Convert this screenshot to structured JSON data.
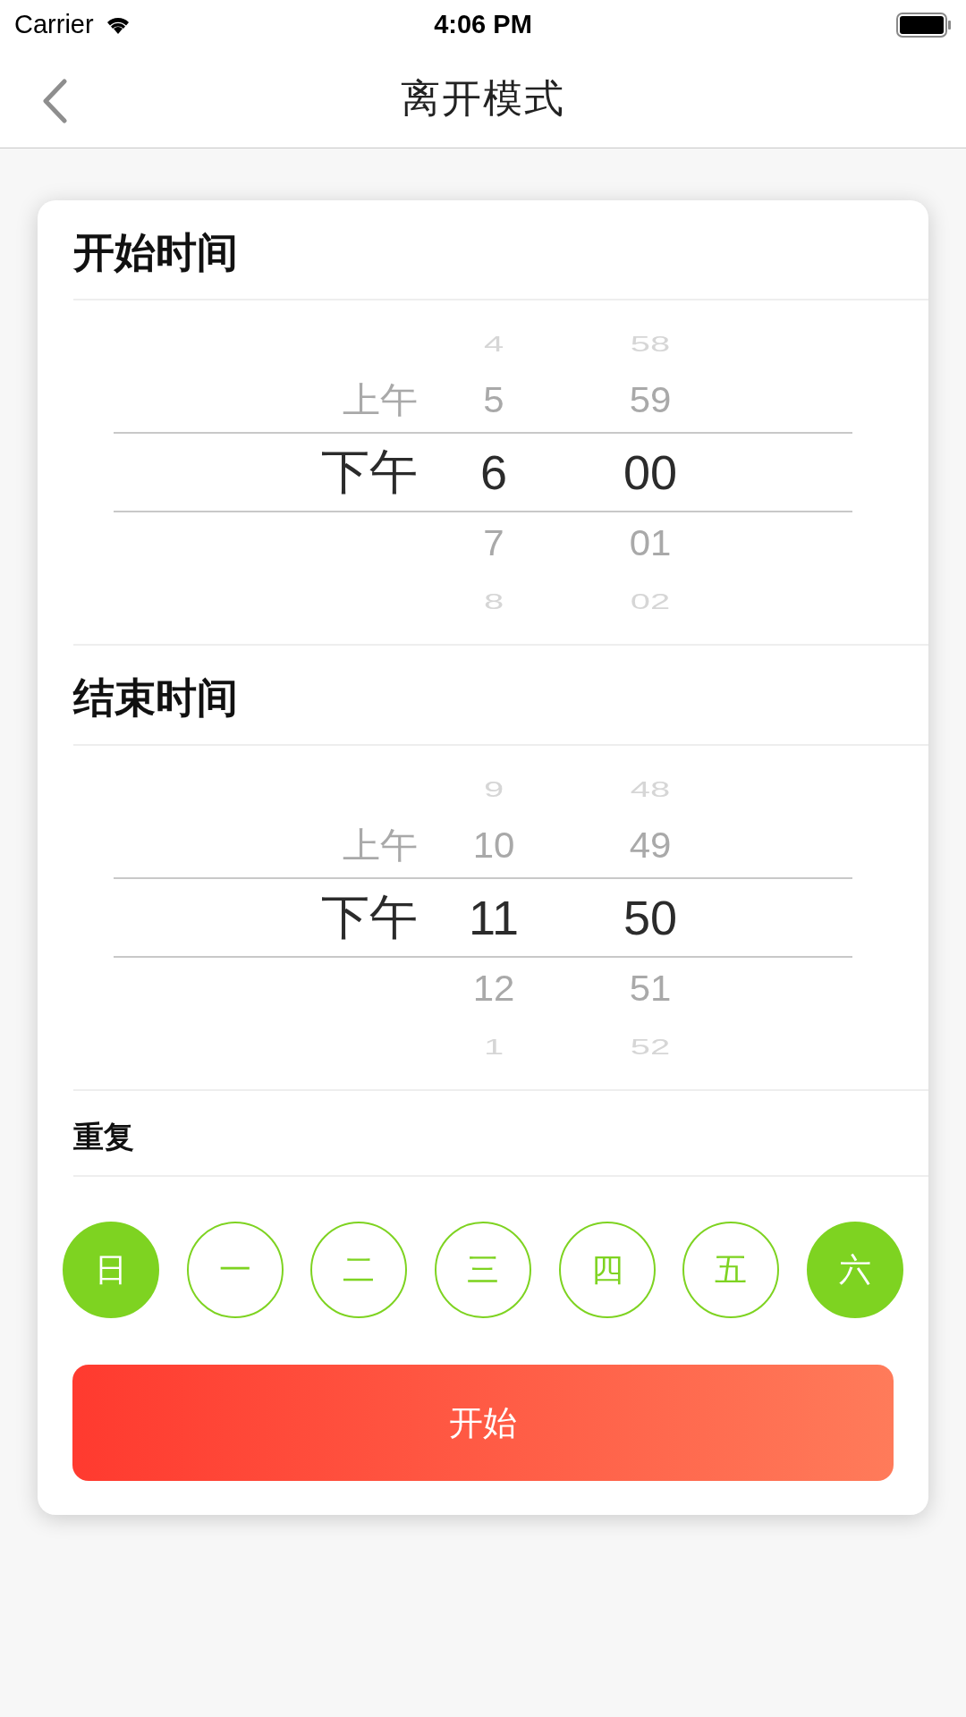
{
  "status_bar": {
    "carrier": "Carrier",
    "time": "4:06 PM"
  },
  "nav": {
    "title": "离开模式"
  },
  "sections": [
    {
      "title": "开始时间",
      "columns": [
        {
          "rows": [
            {
              "text": "上午",
              "selected": false
            },
            {
              "text": "下午",
              "selected": true
            }
          ]
        },
        {
          "rows": [
            {
              "text": "4",
              "selected": false
            },
            {
              "text": "5",
              "selected": false
            },
            {
              "text": "6",
              "selected": true
            },
            {
              "text": "7",
              "selected": false
            },
            {
              "text": "8",
              "selected": false
            }
          ]
        },
        {
          "rows": [
            {
              "text": "58",
              "selected": false
            },
            {
              "text": "59",
              "selected": false
            },
            {
              "text": "00",
              "selected": true
            },
            {
              "text": "01",
              "selected": false
            },
            {
              "text": "02",
              "selected": false
            }
          ]
        }
      ]
    },
    {
      "title": "结束时间",
      "columns": [
        {
          "rows": [
            {
              "text": "上午",
              "selected": false
            },
            {
              "text": "下午",
              "selected": true
            }
          ]
        },
        {
          "rows": [
            {
              "text": "9",
              "selected": false
            },
            {
              "text": "10",
              "selected": false
            },
            {
              "text": "11",
              "selected": true
            },
            {
              "text": "12",
              "selected": false
            },
            {
              "text": "1",
              "selected": false
            }
          ]
        },
        {
          "rows": [
            {
              "text": "48",
              "selected": false
            },
            {
              "text": "49",
              "selected": false
            },
            {
              "text": "50",
              "selected": true
            },
            {
              "text": "51",
              "selected": false
            },
            {
              "text": "52",
              "selected": false
            }
          ]
        }
      ]
    }
  ],
  "repeat": {
    "title": "重复",
    "days": [
      {
        "label": "日",
        "selected": true
      },
      {
        "label": "一",
        "selected": false
      },
      {
        "label": "二",
        "selected": false
      },
      {
        "label": "三",
        "selected": false
      },
      {
        "label": "四",
        "selected": false
      },
      {
        "label": "五",
        "selected": false
      },
      {
        "label": "六",
        "selected": true
      }
    ]
  },
  "start_button": "开始"
}
